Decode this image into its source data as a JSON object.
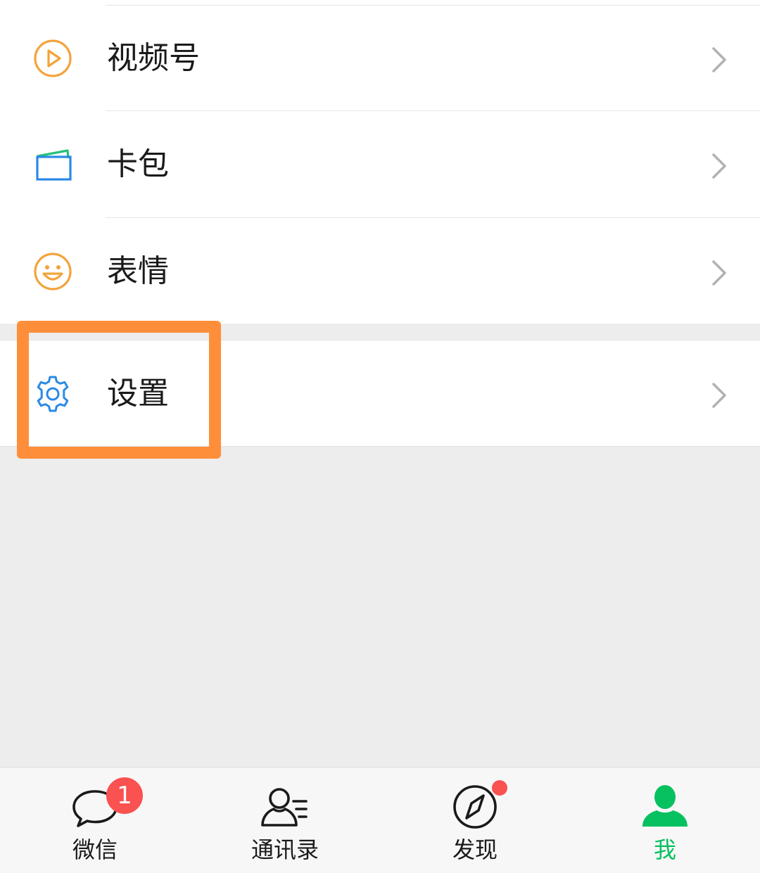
{
  "colors": {
    "accent_green": "#07c160",
    "badge_red": "#fa5151",
    "highlight_orange": "#ff8e3a",
    "channels_icon": "#f3a33b",
    "cards_icon_blue": "#2a8ae6",
    "cards_icon_green": "#25c07a",
    "sticker_icon": "#f3a33b",
    "settings_icon": "#2a8ae6"
  },
  "menu": {
    "items": [
      {
        "label": "视频号",
        "icon": "channels-icon"
      },
      {
        "label": "卡包",
        "icon": "card-wallet-icon"
      },
      {
        "label": "表情",
        "icon": "smile-icon"
      }
    ],
    "settings": {
      "label": "设置",
      "icon": "gear-icon"
    }
  },
  "tabbar": {
    "tabs": [
      {
        "label": "微信",
        "icon": "chat-bubble-icon",
        "badge": "1",
        "active": false
      },
      {
        "label": "通讯录",
        "icon": "contacts-icon",
        "active": false
      },
      {
        "label": "发现",
        "icon": "compass-icon",
        "dot": true,
        "active": false
      },
      {
        "label": "我",
        "icon": "person-icon",
        "active": true
      }
    ]
  }
}
